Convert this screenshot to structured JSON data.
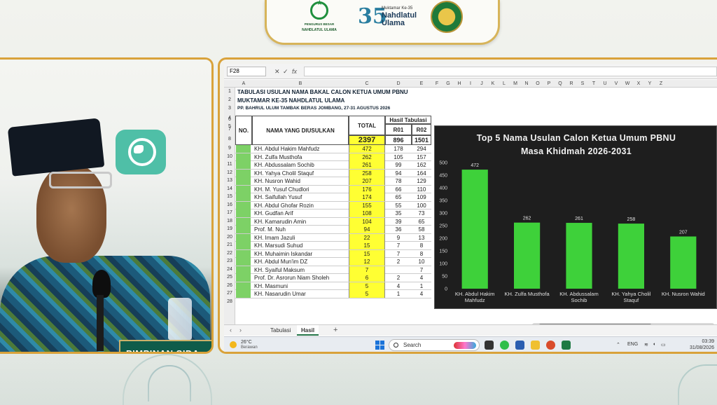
{
  "banner": {
    "nu_caption_line1": "PENGURUS BESAR",
    "nu_caption_line2": "NAHDLATUL ULAMA",
    "muktamar_small": "Muktamar Ke-35",
    "muktamar_name": "Nahdlatul Ulama",
    "muktamar_number": "35"
  },
  "camera": {
    "nameplate": "PIMPINAN SIDA"
  },
  "excel": {
    "name_box": "F28",
    "columns": [
      "A",
      "B",
      "C",
      "D",
      "E",
      "F",
      "G",
      "H",
      "I",
      "J",
      "K",
      "L",
      "M",
      "N",
      "O",
      "P",
      "Q",
      "R",
      "S",
      "T",
      "U",
      "V",
      "W",
      "X",
      "Y",
      "Z"
    ],
    "rows": [
      "1",
      "2",
      "3",
      "4",
      "5",
      "6",
      "7",
      "8",
      "9",
      "10",
      "11",
      "12",
      "13",
      "14",
      "15",
      "16",
      "17",
      "18",
      "19",
      "20",
      "21",
      "22",
      "23",
      "24",
      "25",
      "26",
      "27",
      "28"
    ],
    "title1": "TABULASI USULAN NAMA BAKAL CALON KETUA UMUM PBNU",
    "title2": "MUKTAMAR KE-35 NAHDLATUL ULAMA",
    "title3": "PP. BAHRUL ULUM TAMBAK BERAS JOMBANG, 27-31 AGUSTUS 2026",
    "header_no": "NO.",
    "header_name": "NAMA YANG DIUSULKAN",
    "header_total": "TOTAL",
    "header_hasil": "Hasil Tabulasi",
    "header_r01": "R01",
    "header_r02": "R02",
    "grand_total": "2397",
    "total_r01": "896",
    "total_r02": "1501",
    "data_rows": [
      {
        "name": "KH. Abdul Hakim Mahfudz",
        "total": "472",
        "r01": "178",
        "r02": "294"
      },
      {
        "name": "KH. Zulfa Musthofa",
        "total": "262",
        "r01": "105",
        "r02": "157"
      },
      {
        "name": "KH. Abdussalam Sochib",
        "total": "261",
        "r01": "99",
        "r02": "162"
      },
      {
        "name": "KH. Yahya Cholil Staquf",
        "total": "258",
        "r01": "94",
        "r02": "164"
      },
      {
        "name": "KH. Nusron Wahid",
        "total": "207",
        "r01": "78",
        "r02": "129"
      },
      {
        "name": "KH. M. Yusuf Chudlori",
        "total": "176",
        "r01": "66",
        "r02": "110"
      },
      {
        "name": "KH. Saifullah Yusuf",
        "total": "174",
        "r01": "65",
        "r02": "109"
      },
      {
        "name": "KH. Abdul Ghofar Rozin",
        "total": "155",
        "r01": "55",
        "r02": "100"
      },
      {
        "name": "KH. Gudfan Arif",
        "total": "108",
        "r01": "35",
        "r02": "73"
      },
      {
        "name": "KH. Kamarudin Amin",
        "total": "104",
        "r01": "39",
        "r02": "65"
      },
      {
        "name": "Prof. M. Nuh",
        "total": "94",
        "r01": "36",
        "r02": "58"
      },
      {
        "name": "KH. Imam Jazuli",
        "total": "22",
        "r01": "9",
        "r02": "13"
      },
      {
        "name": "KH. Marsudi Suhud",
        "total": "15",
        "r01": "7",
        "r02": "8"
      },
      {
        "name": "KH. Muhaimin Iskandar",
        "total": "15",
        "r01": "7",
        "r02": "8"
      },
      {
        "name": "KH. Abdul Mun'im DZ",
        "total": "12",
        "r01": "2",
        "r02": "10"
      },
      {
        "name": "KH. Syaiful Maksum",
        "total": "7",
        "r01": "",
        "r02": "7"
      },
      {
        "name": "Prof. Dr. Asrorun Niam Sholeh",
        "total": "6",
        "r01": "2",
        "r02": "4"
      },
      {
        "name": "KH. Masmuni",
        "total": "5",
        "r01": "4",
        "r02": "1"
      },
      {
        "name": "KH. Nasarudin Umar",
        "total": "5",
        "r01": "1",
        "r02": "4"
      }
    ],
    "tabs": [
      "Tabulasi",
      "Hasil"
    ],
    "tab_add": "+"
  },
  "chart_data": {
    "type": "bar",
    "title": "Top 5 Nama Usulan Calon Ketua Umum PBNU",
    "subtitle": "Masa Khidmah 2026-2031",
    "categories": [
      "KH. Abdul Hakim Mahfudz",
      "KH. Zulfa Musthofa",
      "KH. Abdussalam Sochib",
      "KH. Yahya Cholil Staquf",
      "KH. Nusron Wahid"
    ],
    "category_lines": [
      [
        "KH. Abdul Hakim",
        "Mahfudz"
      ],
      [
        "KH. Zulfa Musthofa"
      ],
      [
        "KH. Abdussalam",
        "Sochib"
      ],
      [
        "KH. Yahya Cholil",
        "Staquf"
      ],
      [
        "KH. Nusron Wahid"
      ]
    ],
    "values": [
      472,
      262,
      261,
      258,
      207
    ],
    "value_labels": [
      "472",
      "262",
      "261",
      "258",
      "207"
    ],
    "ylim": [
      0,
      500
    ],
    "yticks": [
      0,
      50,
      100,
      150,
      200,
      250,
      300,
      350,
      400,
      450,
      500
    ],
    "bar_color": "#3ed13a",
    "background": "#1e1e1e",
    "grid": false,
    "legend": "none"
  },
  "taskbar": {
    "temp": "26°C",
    "weather": "Berawan",
    "search_label": "Search",
    "lang": "ENG",
    "time": "03:39",
    "date": "31/08/2026"
  }
}
